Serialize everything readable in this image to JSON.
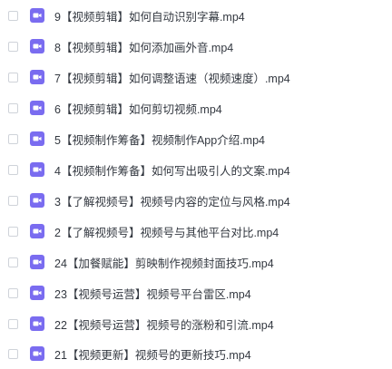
{
  "files": [
    {
      "name": "9【视频剪辑】如何自动识别字幕.mp4",
      "icon": "video-file-icon"
    },
    {
      "name": "8【视频剪辑】如何添加画外音.mp4",
      "icon": "video-file-icon"
    },
    {
      "name": "7【视频剪辑】如何调整语速（视频速度）.mp4",
      "icon": "video-file-icon"
    },
    {
      "name": "6【视频剪辑】如何剪切视频.mp4",
      "icon": "video-file-icon"
    },
    {
      "name": "5【视频制作筹备】视频制作App介绍.mp4",
      "icon": "video-file-icon"
    },
    {
      "name": "4【视频制作筹备】如何写出吸引人的文案.mp4",
      "icon": "video-file-icon"
    },
    {
      "name": "3【了解视频号】视频号内容的定位与风格.mp4",
      "icon": "video-file-icon"
    },
    {
      "name": "2【了解视频号】视频号与其他平台对比.mp4",
      "icon": "video-file-icon"
    },
    {
      "name": "24【加餐赋能】剪映制作视频封面技巧.mp4",
      "icon": "video-file-icon"
    },
    {
      "name": "23【视频号运营】视频号平台雷区.mp4",
      "icon": "video-file-icon"
    },
    {
      "name": "22【视频号运营】视频号的涨粉和引流.mp4",
      "icon": "video-file-icon"
    },
    {
      "name": "21【视频更新】视频号的更新技巧.mp4",
      "icon": "video-file-icon"
    }
  ],
  "colors": {
    "icon_accent": "#7a6cf0",
    "text": "#333840",
    "checkbox_border": "#cfd3d9"
  }
}
